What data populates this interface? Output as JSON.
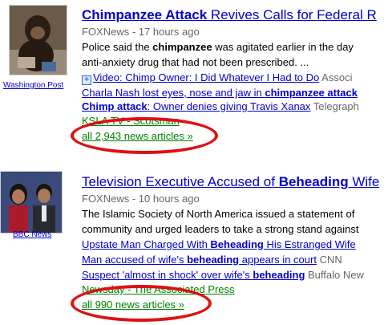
{
  "stories": [
    {
      "source_label": "Washington Post",
      "title_bold": "Chimpanzee Attack",
      "title_rest": " Revives Calls for Federal R",
      "publisher": "FOXNews",
      "time": " - 17 hours ago",
      "snippet_pre": "Police said the ",
      "snippet_bold": "chimpanzee",
      "snippet_post": " was agitated earlier in the day",
      "snippet_line2": "anti-anxiety drug that had not been prescribed. ...",
      "video_link": "Video: Chimp Owner: I Did Whatever I Had to Do",
      "video_src": " Associ",
      "rel1_text": "Charla Nash lost eyes, nose and jaw in ",
      "rel1_bold": "chimpanzee attack",
      "rel2_bold": "Chimp attack",
      "rel2_text": ": Owner denies giving Travis Xanax",
      "rel2_src": " Telegraph",
      "green_src": "KSLA TV - Scotsman",
      "all_articles": "all 2,943 news articles »"
    },
    {
      "source_label": "BBC News",
      "title_pre": "Television Executive Accused of ",
      "title_bold": "Beheading",
      "title_rest": " Wife",
      "publisher": "FOXNews",
      "time": " - 10 hours ago",
      "snippet_line1": "The Islamic Society of North America issued a statement of",
      "snippet_line2": "community and urged leaders to take a strong stand against",
      "rel1_text": "Upstate Man Charged With ",
      "rel1_bold": "Beheading",
      "rel1_rest": " His Estranged Wife",
      "rel2_text": "Man accused of wife's ",
      "rel2_bold": "beheading",
      "rel2_rest": " appears in court",
      "rel2_src": " CNN",
      "rel3_text": "Suspect 'almost in shock' over wife's ",
      "rel3_bold": "beheading",
      "rel3_src": " Buffalo New",
      "green_src": "Newsday - The Associated Press",
      "all_articles": "all 990 news articles »"
    }
  ],
  "colors": {
    "link": "#0000cc",
    "green": "#008000",
    "annotation": "#dd1111"
  }
}
